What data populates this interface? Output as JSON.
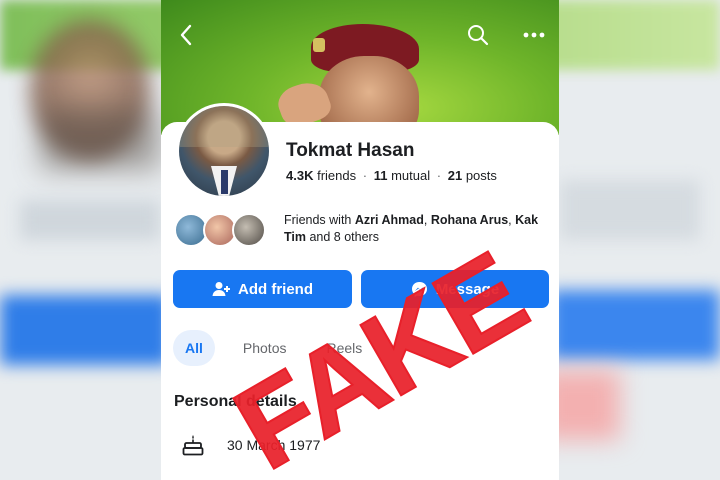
{
  "profile": {
    "name": "Tokmat Hasan",
    "friends_count": "4.3K",
    "friends_label": "friends",
    "mutual_count": "11",
    "mutual_label": "mutual",
    "posts_count": "21",
    "posts_label": "posts"
  },
  "mutual_friends": {
    "prefix": "Friends with",
    "names": [
      "Azri Ahmad",
      "Rohana Arus",
      "Kak Tim"
    ],
    "sep1": ", ",
    "sep2": ", ",
    "suffix": " and 8 others"
  },
  "actions": {
    "add_friend_label": "Add friend",
    "message_label": "Message"
  },
  "tabs": [
    {
      "label": "All",
      "active": true
    },
    {
      "label": "Photos",
      "active": false
    },
    {
      "label": "Reels",
      "active": false
    }
  ],
  "personal_details": {
    "title": "Personal details",
    "birthday": "30 March 1977"
  },
  "stamp": {
    "text": "FAKE",
    "color": "#e8202a"
  },
  "colors": {
    "accent": "#1877f2",
    "tab_active_bg": "#e7f0fd",
    "text_primary": "#1c1e21",
    "text_secondary": "#65676b"
  }
}
